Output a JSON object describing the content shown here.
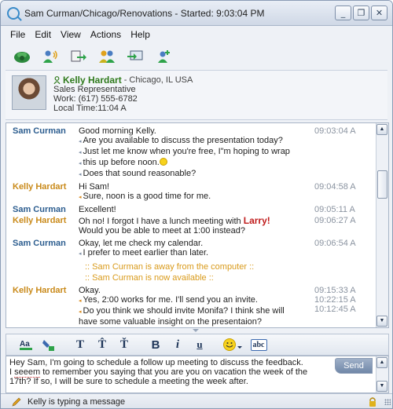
{
  "window": {
    "title": "Sam Curman/Chicago/Renovations - Started: 9:03:04 PM",
    "buttons": {
      "minimize": "_",
      "restore": "❐",
      "close": "✕"
    }
  },
  "menu": [
    "File",
    "Edit",
    "View",
    "Actions",
    "Help"
  ],
  "toolbar": [
    "phone-icon",
    "voice-call-icon",
    "share-icon",
    "people-icon",
    "screen-share-icon",
    "add-user-icon"
  ],
  "contact": {
    "name": "Kelly Hardart",
    "location": "- Chicago, IL USA",
    "title": "Sales Representative",
    "work": "Work: (617) 555-6782",
    "local_time": "Local Time:11:04 A"
  },
  "chat": {
    "messages": [
      {
        "sender": "Sam Curman",
        "who": "sam",
        "lines": [
          {
            "text": "Good morning Kelly.",
            "time": "09:03:04 A"
          },
          {
            "text": "Are you available to discuss the presentation today?",
            "caret": true
          },
          {
            "text": "Just let me know when you're free, I\"m hoping to wrap",
            "caret": true
          },
          {
            "text": "this up before noon.",
            "caret": true,
            "smiley": true
          },
          {
            "text": "Does that sound reasonable?",
            "caret": true
          }
        ]
      },
      {
        "sender": "Kelly Hardart",
        "who": "kelly",
        "lines": [
          {
            "text": "Hi Sam!",
            "time": "09:04:58 A"
          },
          {
            "text": "Sure, noon is a good time for me.",
            "caret": true
          }
        ]
      },
      {
        "sender": "Sam Curman",
        "who": "sam",
        "lines": [
          {
            "text": "Excellent!",
            "time": "09:05:11 A"
          }
        ]
      },
      {
        "sender": "Kelly Hardart",
        "who": "kelly",
        "lines": [
          {
            "text": "Oh no! I forgot I have a lunch meeting with ",
            "highlight": "Larry!",
            "time": "09:06:27 A"
          },
          {
            "text": "Would you be able to meet at 1:00 instead?"
          }
        ]
      },
      {
        "sender": "Sam Curman",
        "who": "sam",
        "lines": [
          {
            "text": "Okay, let me check my calendar.",
            "time": "09:06:54 A"
          },
          {
            "text": "I prefer to meet earlier than later.",
            "caret": true
          }
        ]
      }
    ],
    "system": [
      ":: Sam Curman is away from the computer ::",
      ":: Sam Curman is now available ::"
    ],
    "last": {
      "sender": "Kelly Hardart",
      "lines": [
        {
          "text": "Okay.",
          "time": "09:15:33 A"
        },
        {
          "text": "Yes, 2:00 works for me. I'll send you an invite.",
          "caret": true,
          "time": "10:22:15 A"
        },
        {
          "text": "Do you think we should invite Monifa? I think she will",
          "caret": true,
          "time": "10:12:45 A"
        },
        {
          "text": "have some valuable insight on the presentaion?"
        }
      ]
    }
  },
  "format_bar": {
    "bold": "B",
    "italic": "i",
    "underline": "u",
    "text_style_a": "T",
    "text_style_b": "T̂",
    "text_style_c": "Ť",
    "spell": "abc"
  },
  "input": {
    "line1": "Hey Sam, I'm going to schedule a follow up meeting to discuss the feedback.",
    "line2_pre": "I ",
    "line2_misspell": "seeem",
    "line2_post": " to remember you saying that you are you on vacation the week of the",
    "line3": "17th? If so, I will be sure to schedule a meeting the week after.",
    "send_label": "Send"
  },
  "status": {
    "text": "Kelly is typing a message"
  },
  "colors": {
    "sam": "#2c5d8f",
    "kelly": "#c98a1a",
    "system": "#d99a1a",
    "highlight": "#c01d1d"
  }
}
